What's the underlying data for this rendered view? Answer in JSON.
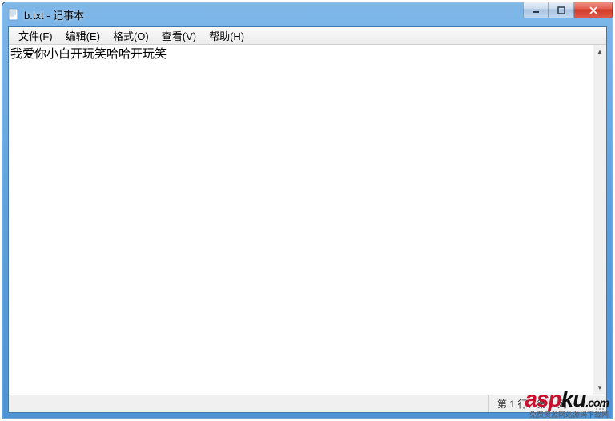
{
  "window": {
    "title": "b.txt - 记事本"
  },
  "menu": {
    "file": "文件(F)",
    "edit": "编辑(E)",
    "format": "格式(O)",
    "view": "查看(V)",
    "help": "帮助(H)"
  },
  "editor": {
    "content": "我爱你小白开玩笑哈哈开玩笑"
  },
  "status": {
    "position": "第 1 行，第 1 列"
  },
  "watermark": {
    "brand_a": "asp",
    "brand_b": "ku",
    "domain": ".com",
    "tagline": "免费资源网站源码下载网"
  }
}
